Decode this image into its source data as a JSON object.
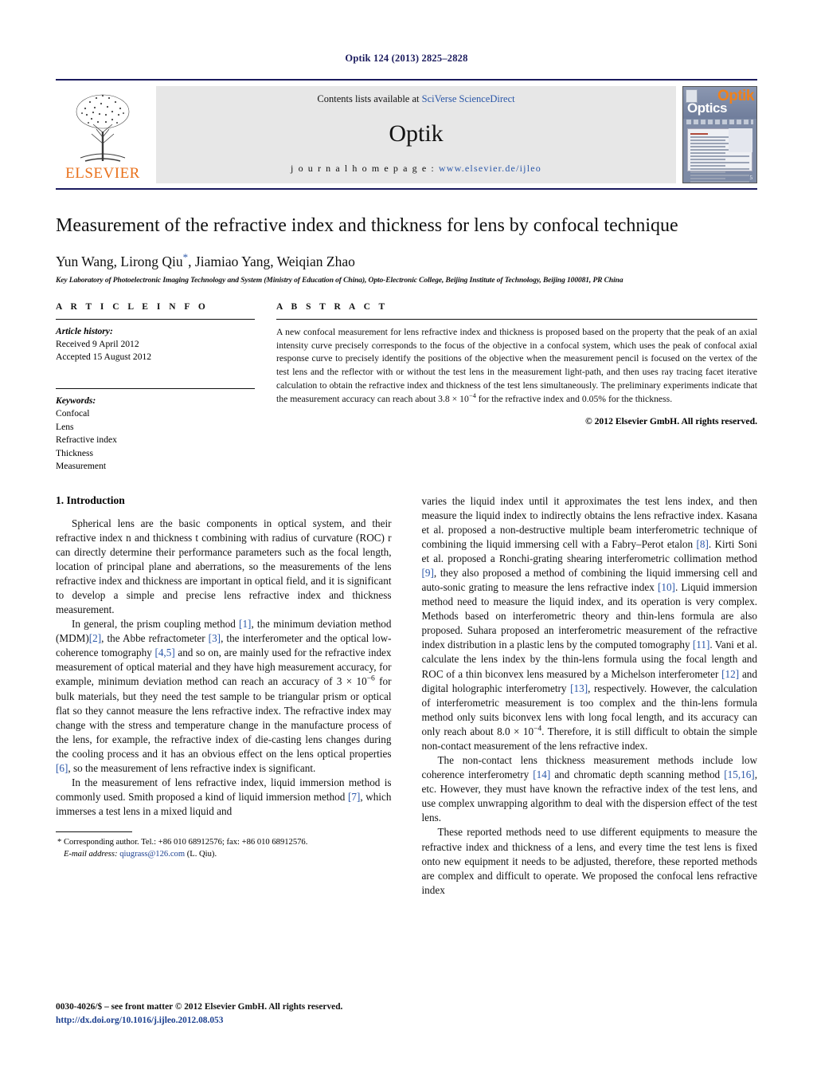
{
  "running_head": "Optik 124 (2013) 2825–2828",
  "banner": {
    "publisher": "ELSEVIER",
    "contents_prefix": "Contents lists available at ",
    "contents_link": "SciVerse ScienceDirect",
    "journal_name": "Optik",
    "homepage_label": "j o u r n a l   h o m e p a g e :   ",
    "homepage_url": "www.elsevier.de/ijleo",
    "cover": {
      "title_top": "Optik",
      "title_bottom": "Optics",
      "issue_number": "5"
    }
  },
  "article": {
    "title": "Measurement of the refractive index and thickness for lens by confocal technique",
    "authors": "Yun Wang, Lirong Qiu",
    "authors_tail": ", Jiamiao Yang, Weiqian Zhao",
    "corresponding_marker": "*",
    "affiliation": "Key Laboratory of Photoelectronic Imaging Technology and System (Ministry of Education of China), Opto-Electronic College, Beijing Institute of Technology, Beijing 100081, PR China"
  },
  "info": {
    "heading": "A R T I C L E   I N F O",
    "history_label": "Article history:",
    "received": "Received 9 April 2012",
    "accepted": "Accepted 15 August 2012",
    "keywords_label": "Keywords:",
    "keywords": [
      "Confocal",
      "Lens",
      "Refractive index",
      "Thickness",
      "Measurement"
    ]
  },
  "abstract": {
    "heading": "A B S T R A C T",
    "text_part1": "A new confocal measurement for lens refractive index and thickness is proposed based on the property that the peak of an axial intensity curve precisely corresponds to the focus of the objective in a confocal system, which uses the peak of confocal axial response curve to precisely identify the positions of the objective when the measurement pencil is focused on the vertex of the test lens and the reflector with or without the test lens in the measurement light-path, and then uses ray tracing facet iterative calculation to obtain the refractive index and thickness of the test lens simultaneously. The preliminary experiments indicate that the measurement accuracy can reach about 3.8 × 10",
    "exp1": "−4",
    "text_part2": " for the refractive index and 0.05% for the thickness.",
    "copyright": "© 2012 Elsevier GmbH. All rights reserved."
  },
  "sections": {
    "intro_heading": "1.  Introduction",
    "left": {
      "p1": "Spherical lens are the basic components in optical system, and their refractive index n and thickness t combining with radius of curvature (ROC) r can directly determine their performance parameters such as the focal length, location of principal plane and aberrations, so the measurements of the lens refractive index and thickness are important in optical field, and it is significant to develop a simple and precise lens refractive index and thickness measurement.",
      "p2_a": "In general, the prism coupling method ",
      "p2_r1": "[1]",
      "p2_b": ", the minimum deviation method (MDM)",
      "p2_r2": "[2]",
      "p2_c": ", the Abbe refractometer ",
      "p2_r3": "[3]",
      "p2_d": ", the interferometer and the optical low-coherence tomography ",
      "p2_r4": "[4,5]",
      "p2_e": " and so on, are mainly used for the refractive index measurement of optical material and they have high measurement accuracy, for example, minimum deviation method can reach an accuracy of 3 × 10",
      "p2_exp": "−6",
      "p2_f": " for bulk materials, but they need the test sample to be triangular prism or optical flat so they cannot measure the lens refractive index. The refractive index may change with the stress and temperature change in the manufacture process of the lens, for example, the refractive index of die-casting lens changes during the cooling process and it has an obvious effect on the lens optical properties ",
      "p2_r5": "[6]",
      "p2_g": ", so the measurement of lens refractive index is significant.",
      "p3_a": "In the measurement of lens refractive index, liquid immersion method is commonly used. Smith proposed a kind of liquid immersion method ",
      "p3_r1": "[7]",
      "p3_b": ", which immerses a test lens in a mixed liquid and"
    },
    "right": {
      "p1_a": "varies the liquid index until it approximates the test lens index, and then measure the liquid index to indirectly obtains the lens refractive index. Kasana et al. proposed a non-destructive multiple beam interferometric technique of combining the liquid immersing cell with a Fabry–Perot etalon ",
      "p1_r1": "[8]",
      "p1_b": ". Kirti Soni et al. proposed a Ronchi-grating shearing interferometric collimation method ",
      "p1_r2": "[9]",
      "p1_c": ", they also proposed a method of combining the liquid immersing cell and auto-sonic grating to measure the lens refractive index ",
      "p1_r3": "[10]",
      "p1_d": ". Liquid immersion method need to measure the liquid index, and its operation is very complex. Methods based on interferometric theory and thin-lens formula are also proposed. Suhara proposed an interferometric measurement of the refractive index distribution in a plastic lens by the computed tomography ",
      "p1_r4": "[11]",
      "p1_e": ". Vani et al. calculate the lens index by the thin-lens formula using the focal length and ROC of a thin biconvex lens measured by a Michelson interferometer ",
      "p1_r5": "[12]",
      "p1_f": " and digital holographic interferometry ",
      "p1_r6": "[13]",
      "p1_g": ", respectively. However, the calculation of interferometric measurement is too complex and the thin-lens formula method only suits biconvex lens with long focal length, and its accuracy can only reach about 8.0 × 10",
      "p1_exp": "−4",
      "p1_h": ". Therefore, it is still difficult to obtain the simple non-contact measurement of the lens refractive index.",
      "p2_a": "The non-contact lens thickness measurement methods include low coherence interferometry ",
      "p2_r1": "[14]",
      "p2_b": " and chromatic depth scanning method ",
      "p2_r2": "[15,16]",
      "p2_c": ", etc. However, they must have known the refractive index of the test lens, and use complex unwrapping algorithm to deal with the dispersion effect of the test lens.",
      "p3": "These reported methods need to use different equipments to measure the refractive index and thickness of a lens, and every time the test lens is fixed onto new equipment it needs to be adjusted, therefore, these reported methods are complex and difficult to operate. We proposed the confocal lens refractive index"
    }
  },
  "footnote": {
    "marker": "*",
    "text": " Corresponding author. Tel.: +86 010 68912576; fax: +86 010 68912576.",
    "email_label": "E-mail address:",
    "email": "qiugrass@126.com",
    "email_owner": "(L. Qiu)."
  },
  "footer": {
    "line1": "0030-4026/$ – see front matter © 2012 Elsevier GmbH. All rights reserved.",
    "line2": "http://dx.doi.org/10.1016/j.ijleo.2012.08.053"
  }
}
